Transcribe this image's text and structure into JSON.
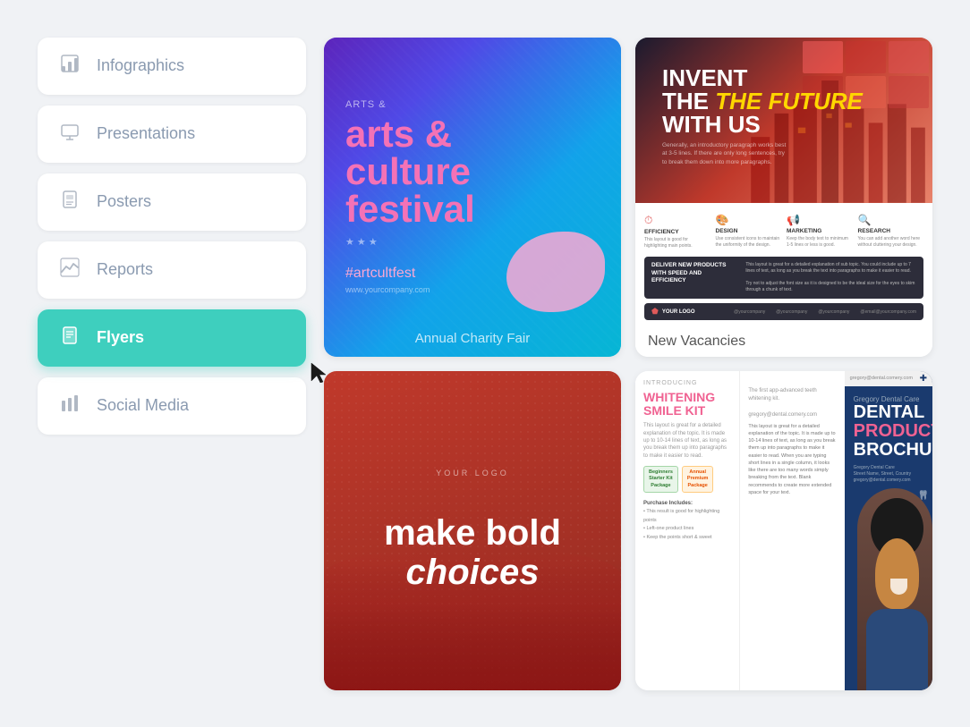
{
  "sidebar": {
    "items": [
      {
        "id": "infographics",
        "label": "Infographics",
        "icon": "▦",
        "active": false
      },
      {
        "id": "presentations",
        "label": "Presentations",
        "icon": "🖼",
        "active": false
      },
      {
        "id": "posters",
        "label": "Posters",
        "icon": "🖼",
        "active": false
      },
      {
        "id": "reports",
        "label": "Reports",
        "icon": "📈",
        "active": false
      },
      {
        "id": "flyers",
        "label": "Flyers",
        "icon": "📋",
        "active": true
      },
      {
        "id": "social-media",
        "label": "Social Media",
        "icon": "📊",
        "active": false
      }
    ]
  },
  "cards": {
    "arts": {
      "title": "arts & culture festival",
      "hashtag": "#artcultfest",
      "label": "Annual Charity Fair"
    },
    "future": {
      "headline_line1": "INVENT",
      "headline_line2": "THE FUTURE",
      "headline_line3": "WITH US",
      "features": [
        {
          "icon": "🕐",
          "title": "EFFICIENCY",
          "desc": "This layout is good for highlighting main points."
        },
        {
          "icon": "🎨",
          "title": "DESIGN",
          "desc": "Use consistent icons to maintain the uniformity of the design."
        },
        {
          "icon": "📢",
          "title": "MARKETING",
          "desc": "Keep the body text to minimum 1-5 lines or less is good."
        },
        {
          "icon": "🔍",
          "title": "RESEARCH",
          "desc": "You can add another word here without cluttering your design."
        }
      ],
      "deliver_title": "DELIVER NEW PRODUCTS WITH SPEED AND EFFICIENCY",
      "deliver_desc": "This layout is great for a detailed explanation of sub topic. You could include up to 7 lines of text, as long as you break the text into paragraphs to make it easier to read.",
      "label": "New Vacancies"
    },
    "bold": {
      "logo": "YOUR LOGO",
      "headline1": "make bold",
      "headline2": "choices"
    },
    "dental": {
      "introducing": "INTRODUCING",
      "whitening_title": "WHITENING SMILE KIT",
      "packages": [
        {
          "label": "Beginners Starter Kit Package",
          "type": "starter"
        },
        {
          "label": "Annual Premium Package",
          "type": "premium"
        }
      ],
      "features_label": "Purchase Includes:",
      "features": [
        "This result is good for highlighting points",
        "Left-one product lines",
        "Keep the points short & sweet"
      ],
      "brochure_pre": "Dental Care",
      "brochure_title1": "DENTAL",
      "brochure_title2": "PRODUCT",
      "brochure_title3": "BROCHURE"
    }
  }
}
